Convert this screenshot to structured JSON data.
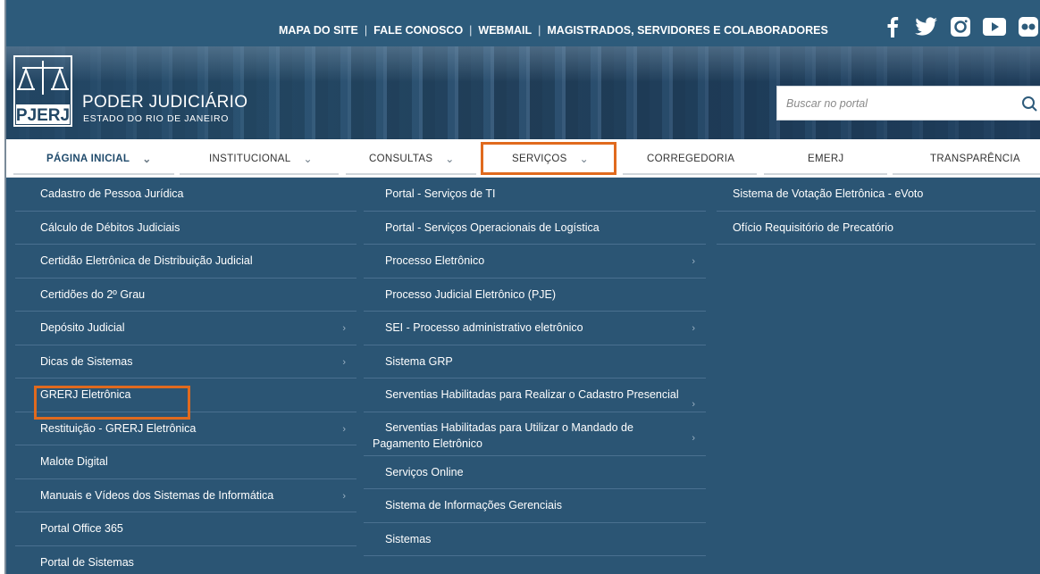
{
  "top_links": [
    "MAPA DO SITE",
    "FALE CONOSCO",
    "WEBMAIL",
    "MAGISTRADOS, SERVIDORES E COLABORADORES"
  ],
  "social": [
    "facebook-icon",
    "twitter-icon",
    "instagram-icon",
    "youtube-icon",
    "flickr-icon"
  ],
  "brand": {
    "logo_text": "PJERJ",
    "title": "PODER JUDICIÁRIO",
    "subtitle": "ESTADO DO RIO DE JANEIRO"
  },
  "search": {
    "placeholder": "Buscar no portal"
  },
  "nav": [
    {
      "label": "PÁGINA INICIAL",
      "has_chevron": true,
      "active": true
    },
    {
      "label": "INSTITUCIONAL",
      "has_chevron": true
    },
    {
      "label": "CONSULTAS",
      "has_chevron": true
    },
    {
      "label": "SERVIÇOS",
      "has_chevron": true,
      "highlighted": true
    },
    {
      "label": "CORREGEDORIA",
      "has_chevron": false
    },
    {
      "label": "EMERJ",
      "has_chevron": false
    },
    {
      "label": "TRANSPARÊNCIA",
      "has_chevron": false
    }
  ],
  "menu": {
    "col1": [
      {
        "label": "Cadastro de Pessoa Jurídica"
      },
      {
        "label": "Cálculo de Débitos Judiciais"
      },
      {
        "label": "Certidão Eletrônica de Distribuição Judicial"
      },
      {
        "label": "Certidões do 2º Grau"
      },
      {
        "label": "Depósito Judicial",
        "submenu": true
      },
      {
        "label": "Dicas de Sistemas",
        "submenu": true
      },
      {
        "label": "GRERJ Eletrônica",
        "highlighted": true
      },
      {
        "label": "Restituição - GRERJ Eletrônica",
        "submenu": true
      },
      {
        "label": "Malote Digital"
      },
      {
        "label": "Manuais e Vídeos dos Sistemas de Informática",
        "submenu": true
      },
      {
        "label": "Portal Office 365"
      },
      {
        "label": "Portal de Sistemas"
      }
    ],
    "col2": [
      {
        "label": "Portal - Serviços de TI"
      },
      {
        "label": "Portal - Serviços Operacionais de Logística"
      },
      {
        "label": "Processo Eletrônico",
        "submenu": true
      },
      {
        "label": "Processo Judicial Eletrônico (PJE)"
      },
      {
        "label": "SEI - Processo administrativo eletrônico",
        "submenu": true
      },
      {
        "label": "Sistema GRP"
      },
      {
        "label": "Serventias Habilitadas para Realizar o Cadastro Presencial",
        "submenu": true
      },
      {
        "label": "Serventias Habilitadas para Utilizar o Mandado de Pagamento Eletrônico",
        "submenu": true
      },
      {
        "label": "Serviços Online"
      },
      {
        "label": "Sistema de Informações Gerenciais"
      },
      {
        "label": "Sistemas"
      }
    ],
    "col3": [
      {
        "label": "Sistema de Votação Eletrônica - eVoto"
      },
      {
        "label": "Ofício Requisitório de Precatório"
      }
    ]
  },
  "colors": {
    "menu_bg": "#2b5574",
    "highlight": "#e06a1e",
    "nav_active": "#1f4a6b"
  }
}
